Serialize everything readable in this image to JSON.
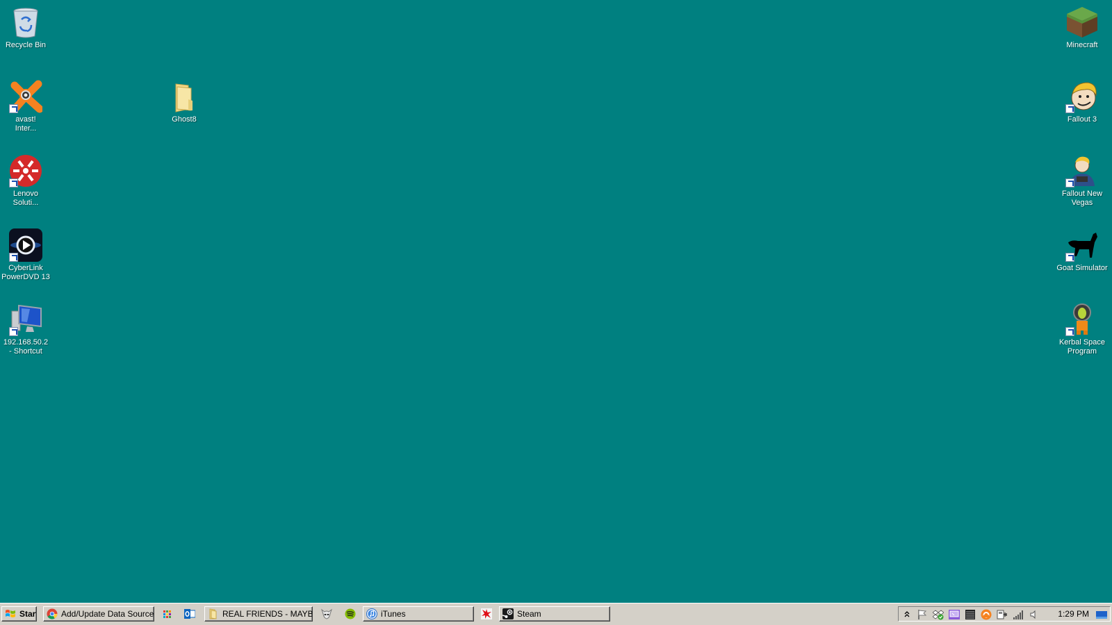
{
  "desktop": {
    "background_color": "#008080",
    "icons_left": [
      {
        "label": "Recycle Bin",
        "icon": "recycle-bin-icon",
        "shortcut": false
      },
      {
        "label": "avast!\nInter...",
        "icon": "avast-icon",
        "shortcut": true
      },
      {
        "label": "Lenovo\nSoluti...",
        "icon": "lenovo-solution-center-icon",
        "shortcut": true
      },
      {
        "label": "CyberLink\nPowerDVD 13",
        "icon": "powerdvd-icon",
        "shortcut": true
      },
      {
        "label": "192.168.50.2\n- Shortcut",
        "icon": "network-computer-icon",
        "shortcut": true
      }
    ],
    "icon_folder": {
      "label": "Ghost8",
      "icon": "folder-icon",
      "shortcut": false
    },
    "icons_right": [
      {
        "label": "Minecraft",
        "icon": "minecraft-icon",
        "shortcut": false
      },
      {
        "label": "Fallout 3",
        "icon": "fallout3-icon",
        "shortcut": true
      },
      {
        "label": "Fallout New\nVegas",
        "icon": "fallout-new-vegas-icon",
        "shortcut": true
      },
      {
        "label": "Goat Simulator",
        "icon": "goat-simulator-icon",
        "shortcut": true
      },
      {
        "label": "Kerbal Space\nProgram",
        "icon": "kerbal-space-program-icon",
        "shortcut": true
      }
    ]
  },
  "taskbar": {
    "start_label": "Start",
    "buttons": [
      {
        "label": "Add/Update Data Source...",
        "icon": "chrome-icon"
      },
      {
        "label": "REAL FRIENDS - MAYB...",
        "icon": "folder-icon"
      },
      {
        "label": "iTunes",
        "icon": "itunes-icon"
      },
      {
        "label": "Steam",
        "icon": "steam-icon"
      }
    ],
    "quick_icons": [
      "apps-grid-icon",
      "outlook-icon",
      "alienware-icon",
      "spotify-icon",
      "splat-icon"
    ],
    "tray": {
      "icons": [
        "show-hidden-icons-chevron",
        "action-center-flag-icon",
        "dropbox-sync-icon",
        "display-icon",
        "keyboard-icon",
        "avast-tray-icon",
        "power-plug-icon",
        "network-signal-icon",
        "volume-icon"
      ],
      "clock": "1:29 PM"
    }
  }
}
